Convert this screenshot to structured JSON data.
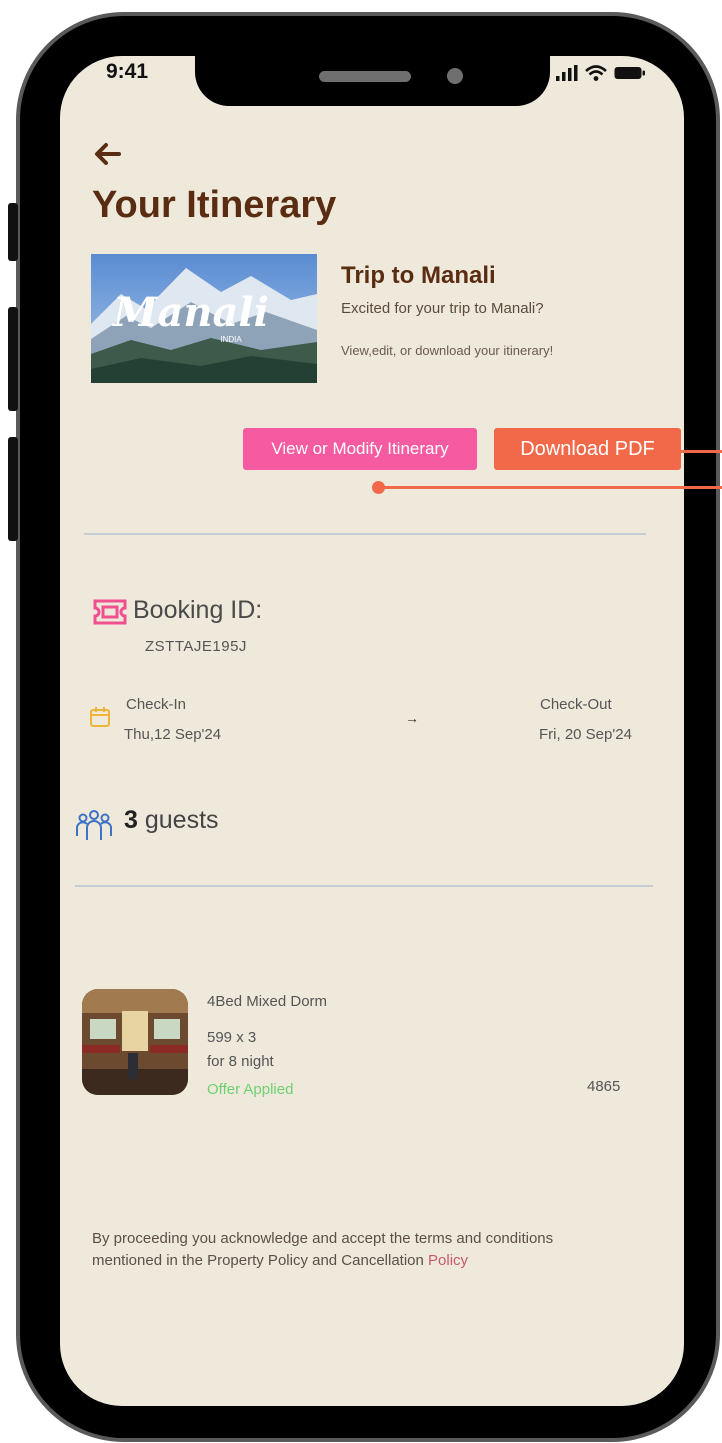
{
  "status_bar": {
    "time": "9:41"
  },
  "header": {
    "title": "Your Itinerary"
  },
  "trip": {
    "image_text": "Manali",
    "image_subtext": "INDIA",
    "title": "Trip to Manali",
    "subtitle": "Excited for your trip to Manali?",
    "note": "View,edit, or download your itinerary!"
  },
  "actions": {
    "view_label": "View or Modify Itinerary",
    "download_label": "Download PDF"
  },
  "booking": {
    "label": "Booking ID:",
    "id": "ZSTTAJE195J",
    "checkin_label": "Check-In",
    "checkin_date": "Thu,12 Sep'24",
    "arrow": "→",
    "checkout_label": "Check-Out",
    "checkout_date": "Fri, 20 Sep'24",
    "guest_count": "3",
    "guest_word": " guests"
  },
  "room": {
    "name": "4Bed Mixed Dorm",
    "rate": "599 x 3",
    "nights": "for 8 night",
    "offer": "Offer Applied",
    "total": "4865"
  },
  "legal": {
    "text": "By proceeding you acknowledge and accept the terms and conditions mentioned in the Property Policy and Cancellation",
    "link": "Policy"
  },
  "colors": {
    "screen_bg": "#efe9dc",
    "title_brown": "#5a2d12",
    "view_button": "#f65aa1",
    "download_button": "#f2694a",
    "offer_green": "#6fd06f",
    "accent_pink": "#f0508f",
    "calendar_amber": "#f0b43a",
    "guests_blue": "#3d73c4"
  },
  "icons": [
    "back-arrow-icon",
    "ticket-icon",
    "calendar-icon",
    "guests-icon",
    "signal-icon",
    "wifi-icon",
    "battery-icon"
  ]
}
